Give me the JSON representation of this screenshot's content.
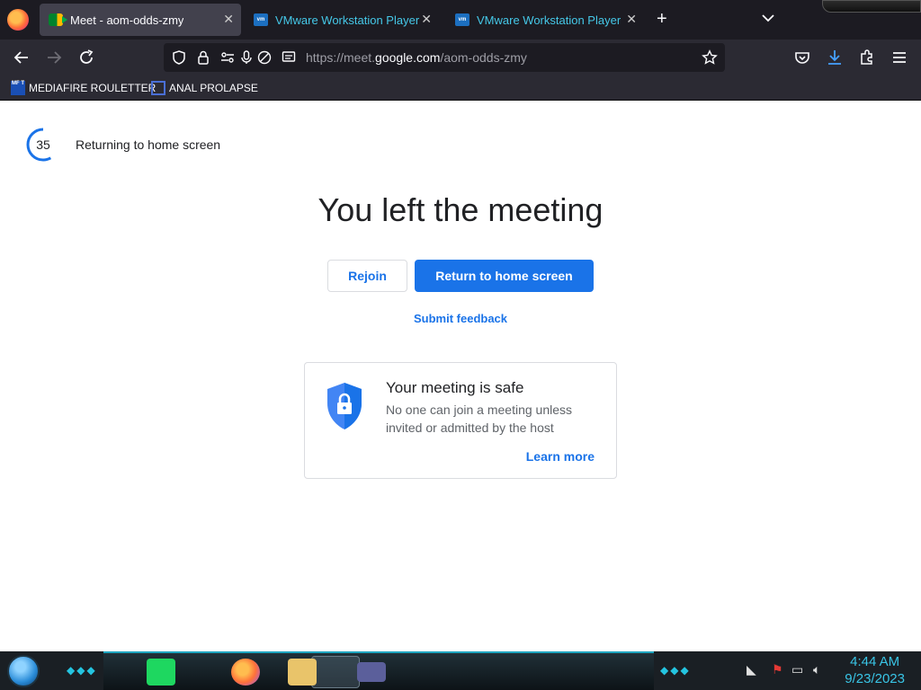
{
  "browser": {
    "tabs": [
      {
        "title": "Meet - aom-odds-zmy",
        "icon": "google-meet-icon",
        "active": true
      },
      {
        "title": "VMware Workstation Player | VM",
        "icon": "vmware-icon",
        "active": false
      },
      {
        "title": "VMware Workstation Player - VM",
        "icon": "vmware-icon",
        "active": false
      }
    ],
    "url_prefix": "https://meet.",
    "url_host": "google.com",
    "url_path": "/aom-odds-zmy",
    "bookmarks": [
      {
        "label": "MEDIAFIRE ROULETTER",
        "icon_text": "MF T"
      },
      {
        "label": "ANAL PROLAPSE"
      }
    ]
  },
  "page": {
    "countdown_value": "35",
    "countdown_fraction": 0.58,
    "returning_text": "Returning to home screen",
    "heading": "You left the meeting",
    "rejoin_label": "Rejoin",
    "return_label": "Return to home screen",
    "feedback_label": "Submit feedback",
    "card": {
      "title": "Your meeting is safe",
      "body": "No one can join a meeting unless invited or admitted by the host",
      "learn_more": "Learn more"
    }
  },
  "taskbar": {
    "time": "4:44 AM",
    "date": "9/23/2023"
  },
  "colors": {
    "accent": "#1a73e8",
    "tab_bg": "#1c1b22",
    "toolbar_bg": "#2b2a33",
    "taskbar_accent": "#39c5e6"
  }
}
